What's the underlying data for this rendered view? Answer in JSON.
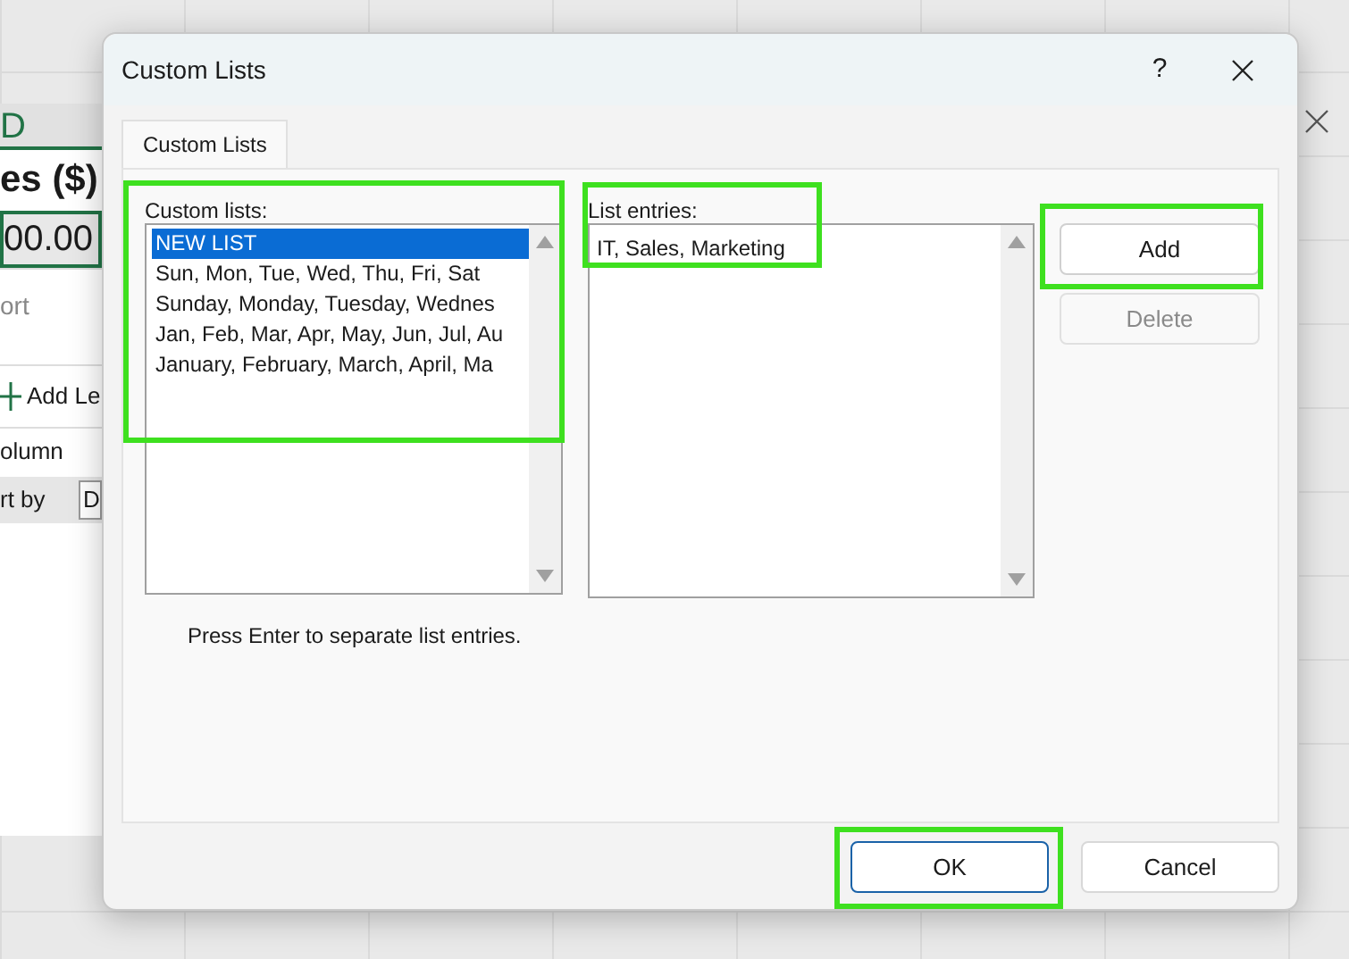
{
  "background": {
    "column_header": "D",
    "header_cell": "es ($)",
    "value_cell": "00.00",
    "sort_title": "ort",
    "add_level": "Add Le",
    "column_label": "olumn",
    "sort_by_label": "rt by",
    "sort_by_value": "D"
  },
  "dialog": {
    "title": "Custom Lists",
    "help": "?"
  },
  "tabs": [
    {
      "label": "Custom Lists",
      "selected": true
    }
  ],
  "custom_lists": {
    "label": "Custom lists:",
    "highlighted": true,
    "items": [
      {
        "text": "NEW LIST",
        "selected": true
      },
      {
        "text": "Sun, Mon, Tue, Wed, Thu, Fri, Sat",
        "selected": false
      },
      {
        "text": "Sunday, Monday, Tuesday, Wednes",
        "selected": false
      },
      {
        "text": "Jan, Feb, Mar, Apr, May, Jun, Jul, Au",
        "selected": false
      },
      {
        "text": "January, February, March, April, Ma",
        "selected": false
      }
    ]
  },
  "list_entries": {
    "label": "List entries:",
    "value": "IT, Sales, Marketing",
    "highlighted": true
  },
  "side_buttons": [
    {
      "label": "Add",
      "disabled": false,
      "highlighted": true
    },
    {
      "label": "Delete",
      "disabled": true,
      "highlighted": false
    }
  ],
  "hint": "Press Enter to separate list entries.",
  "footer_buttons": [
    {
      "label": "OK",
      "default": true,
      "highlighted": true
    },
    {
      "label": "Cancel",
      "default": false,
      "highlighted": false
    }
  ]
}
